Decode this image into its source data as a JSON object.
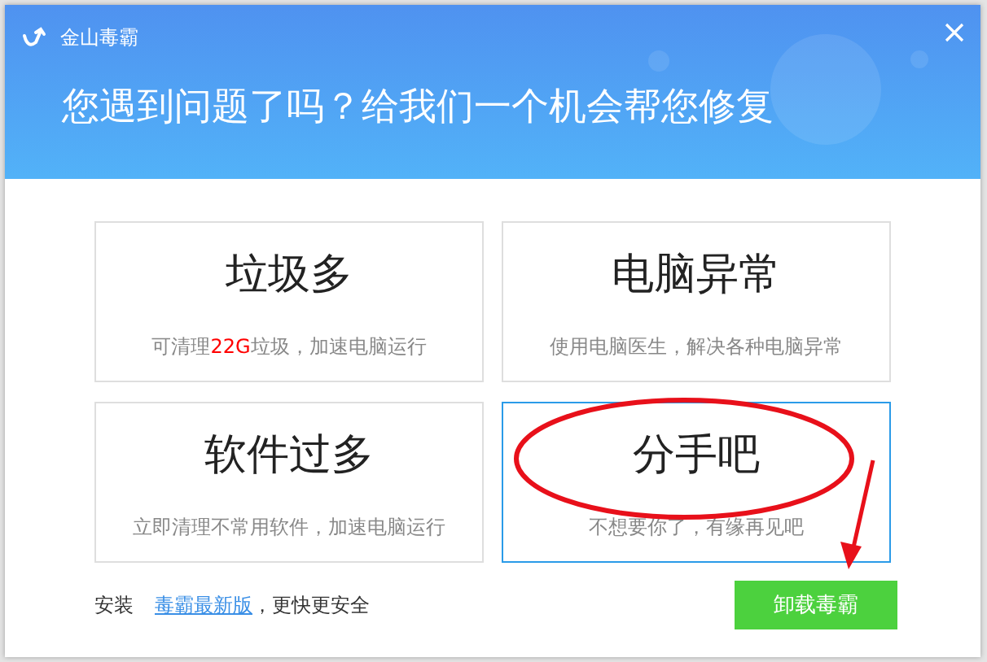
{
  "window": {
    "title": "金山毒霸"
  },
  "headline": "您遇到问题了吗？给我们一个机会帮您修复",
  "options": [
    {
      "title": "垃圾多",
      "selected": false,
      "desc": [
        {
          "text": "可清理",
          "highlight": false
        },
        {
          "text": "22G",
          "highlight": true
        },
        {
          "text": "垃圾，加速电脑运行",
          "highlight": false
        }
      ]
    },
    {
      "title": "电脑异常",
      "selected": false,
      "desc": [
        {
          "text": "使用电脑医生，解决各种电脑异常",
          "highlight": false
        }
      ]
    },
    {
      "title": "软件过多",
      "selected": false,
      "desc": [
        {
          "text": "立即清理不常用软件，加速电脑运行",
          "highlight": false
        }
      ]
    },
    {
      "title": "分手吧",
      "selected": true,
      "desc": [
        {
          "text": "不想要你了，有缘再见吧",
          "highlight": false
        }
      ]
    }
  ],
  "footer": {
    "prefix": "安装",
    "link": "毒霸最新版",
    "suffix": "，更快更安全",
    "button": "卸载毒霸"
  }
}
